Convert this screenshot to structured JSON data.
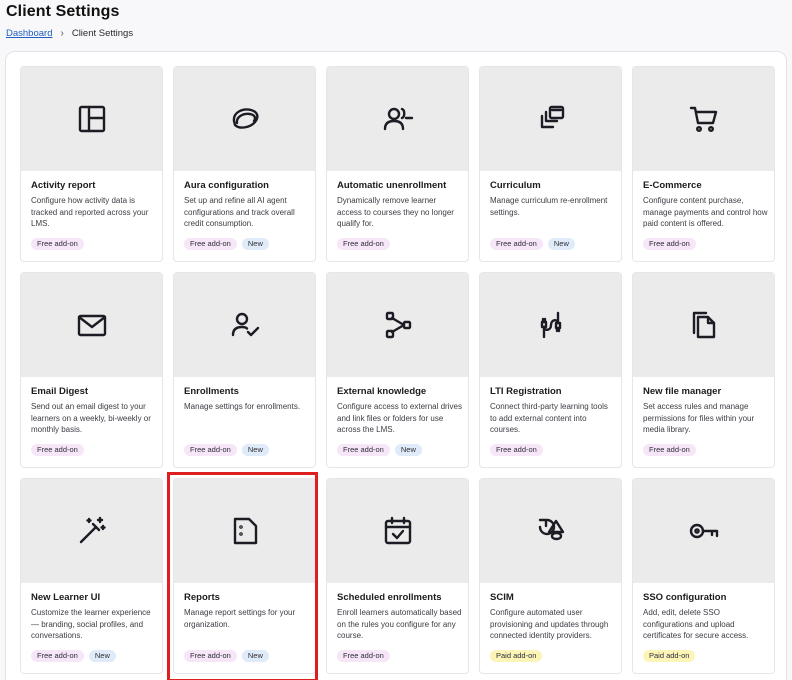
{
  "header": {
    "title": "Client Settings"
  },
  "breadcrumb": {
    "home": "Dashboard",
    "separator": "›",
    "current": "Client Settings"
  },
  "cards": [
    {
      "title": "Activity report",
      "icon": "layout-icon",
      "description": "Configure how activity data is tracked and reported across your LMS.",
      "badges": [
        "Free add-on"
      ]
    },
    {
      "title": "Aura configuration",
      "icon": "aura-icon",
      "description": "Set up and refine all AI agent configurations and track overall credit consumption.",
      "badges": [
        "Free add-on",
        "New"
      ]
    },
    {
      "title": "Automatic unenrollment",
      "icon": "user-minus-icon",
      "description": "Dynamically remove learner access to courses they no longer qualify for.",
      "badges": [
        "Free add-on"
      ]
    },
    {
      "title": "Curriculum",
      "icon": "stack-icon",
      "description": "Manage curriculum re-enrollment settings.",
      "badges": [
        "Free add-on",
        "New"
      ]
    },
    {
      "title": "E-Commerce",
      "icon": "cart-icon",
      "description": "Configure content purchase, manage payments and control how paid content is offered.",
      "badges": [
        "Free add-on"
      ]
    },
    {
      "title": "Email Digest",
      "icon": "mail-icon",
      "description": "Send out an email digest to your learners on a weekly, bi-weekly or monthly basis.",
      "badges": [
        "Free add-on"
      ]
    },
    {
      "title": "Enrollments",
      "icon": "user-check-icon",
      "description": "Manage settings for enrollments.",
      "badges": [
        "Free add-on",
        "New"
      ]
    },
    {
      "title": "External knowledge",
      "icon": "share-nodes-icon",
      "description": "Configure access to external drives and link files or folders for use across the LMS.",
      "badges": [
        "Free add-on",
        "New"
      ]
    },
    {
      "title": "LTI Registration",
      "icon": "plug-icon",
      "description": "Connect third-party learning tools to add external content into courses.",
      "badges": [
        "Free add-on"
      ]
    },
    {
      "title": "New file manager",
      "icon": "files-icon",
      "description": "Set access rules and manage permissions for files within your media library.",
      "badges": [
        "Free add-on"
      ]
    },
    {
      "title": "New Learner UI",
      "icon": "magic-wand-icon",
      "description": "Customize the learner experience — branding, social profiles, and conversations.",
      "badges": [
        "Free add-on",
        "New"
      ]
    },
    {
      "title": "Reports",
      "icon": "report-icon",
      "description": "Manage report settings for your organization.",
      "badges": [
        "Free add-on",
        "New"
      ]
    },
    {
      "title": "Scheduled enrollments",
      "icon": "calendar-check-icon",
      "description": "Enroll learners automatically based on the rules you configure for any course.",
      "badges": [
        "Free add-on"
      ]
    },
    {
      "title": "SCIM",
      "icon": "shapes-icon",
      "description": "Configure automated user provisioning and updates through connected identity providers.",
      "badges": [
        "Paid add-on"
      ]
    },
    {
      "title": "SSO configuration",
      "icon": "key-icon",
      "description": "Add, edit, delete SSO configurations and upload certificates for secure access.",
      "badges": [
        "Paid add-on"
      ]
    }
  ],
  "colors": {
    "highlight": "#dd1f1f",
    "link": "#1f5fbf",
    "free_badge": "#f6e6f8",
    "new_badge": "#dfebf9",
    "paid_badge": "#fdf5b8",
    "icon": "#1c1c24"
  }
}
